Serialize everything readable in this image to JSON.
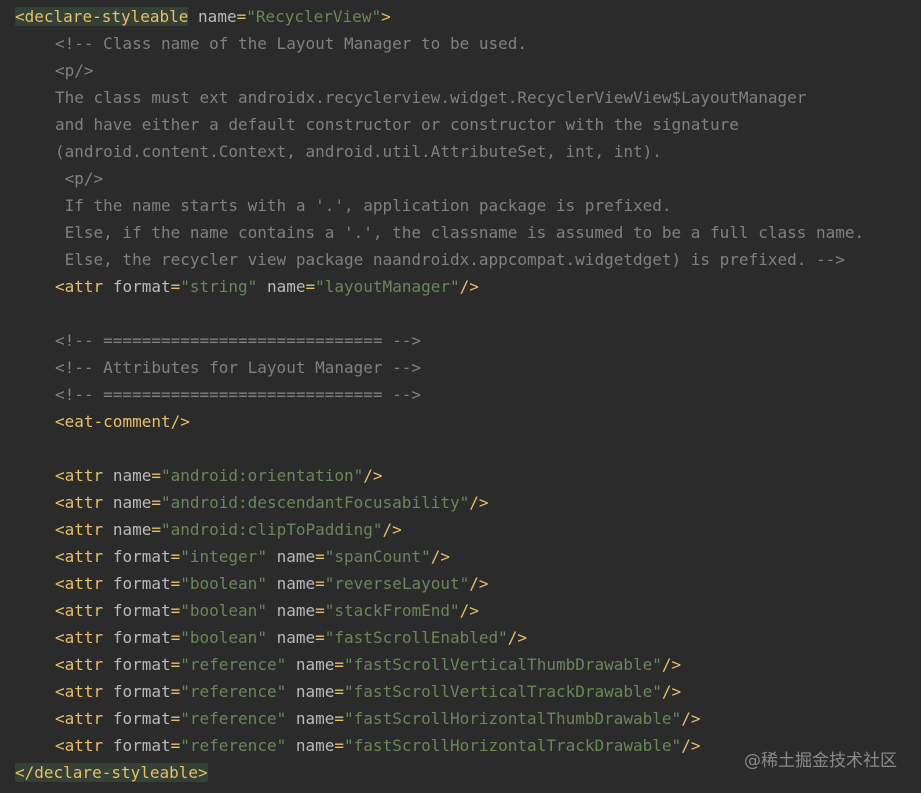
{
  "code": {
    "open_tag": "declare-styleable",
    "open_attr": "name",
    "open_value": "\"RecyclerView\"",
    "comment_block": [
      "<!-- Class name of the Layout Manager to be used.",
      "<p/>",
      "The class must ext androidx.recyclerview.widget.RecyclerViewView$LayoutManager",
      "and have either a default constructor or constructor with the signature",
      "(android.content.Context, android.util.AttributeSet, int, int).",
      " <p/>",
      " If the name starts with a '.', application package is prefixed.",
      " Else, if the name contains a '.', the classname is assumed to be a full class name.",
      " Else, the recycler view package naandroidx.appcompat.widgetdget) is prefixed. -->"
    ],
    "attr_layout_manager": {
      "format": "\"string\"",
      "name": "\"layoutManager\""
    },
    "section_comments": [
      "<!-- ============================= -->",
      "<!-- Attributes for Layout Manager -->",
      "<!-- ============================= -->"
    ],
    "eat_comment": "eat-comment",
    "attrs": [
      {
        "format": "",
        "name": "\"android:orientation\""
      },
      {
        "format": "",
        "name": "\"android:descendantFocusability\""
      },
      {
        "format": "",
        "name": "\"android:clipToPadding\""
      },
      {
        "format": "\"integer\"",
        "name": "\"spanCount\""
      },
      {
        "format": "\"boolean\"",
        "name": "\"reverseLayout\""
      },
      {
        "format": "\"boolean\"",
        "name": "\"stackFromEnd\""
      },
      {
        "format": "\"boolean\"",
        "name": "\"fastScrollEnabled\""
      },
      {
        "format": "\"reference\"",
        "name": "\"fastScrollVerticalThumbDrawable\""
      },
      {
        "format": "\"reference\"",
        "name": "\"fastScrollVerticalTrackDrawable\""
      },
      {
        "format": "\"reference\"",
        "name": "\"fastScrollHorizontalThumbDrawable\""
      },
      {
        "format": "\"reference\"",
        "name": "\"fastScrollHorizontalTrackDrawable\""
      }
    ],
    "close_tag": "declare-styleable",
    "kw_attr": "attr",
    "kw_format": "format",
    "kw_name": "name"
  },
  "watermark": "@稀土掘金技术社区"
}
